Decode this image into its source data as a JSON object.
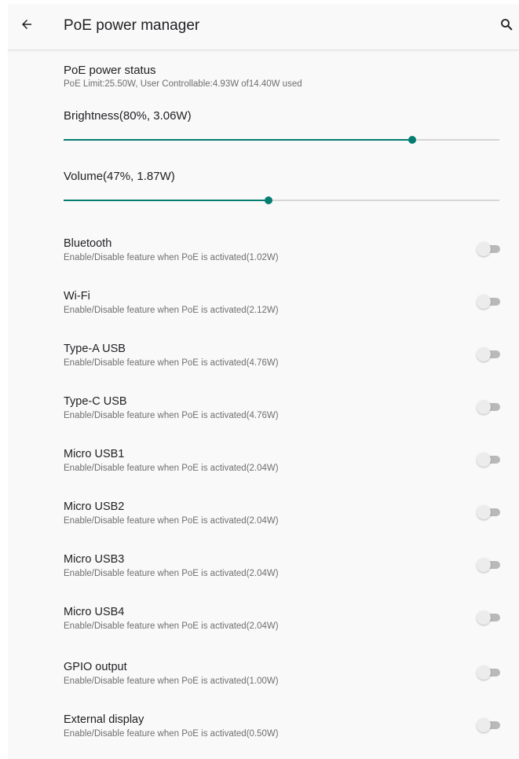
{
  "appbar": {
    "title": "PoE power manager",
    "back_icon": "arrow-back-icon",
    "search_icon": "search-icon"
  },
  "status": {
    "title": "PoE power status",
    "summary": "PoE Limit:25.50W, User Controllable:4.93W of14.40W used"
  },
  "sliders": [
    {
      "label": "Brightness(80%, 3.06W)",
      "percent": 80
    },
    {
      "label": "Volume(47%, 1.87W)",
      "percent": 47
    }
  ],
  "settings": [
    {
      "title": "Bluetooth",
      "subtitle": "Enable/Disable feature when PoE is activated(1.02W)",
      "enabled": false
    },
    {
      "title": "Wi-Fi",
      "subtitle": "Enable/Disable feature when PoE is activated(2.12W)",
      "enabled": false
    },
    {
      "title": "Type-A USB",
      "subtitle": "Enable/Disable feature when PoE is activated(4.76W)",
      "enabled": false
    },
    {
      "title": "Type-C USB",
      "subtitle": "Enable/Disable feature when PoE is activated(4.76W)",
      "enabled": false
    },
    {
      "title": "Micro USB1",
      "subtitle": "Enable/Disable feature when PoE is activated(2.04W)",
      "enabled": false
    },
    {
      "title": "Micro USB2",
      "subtitle": "Enable/Disable feature when PoE is activated(2.04W)",
      "enabled": false
    },
    {
      "title": "Micro USB3",
      "subtitle": "Enable/Disable feature when PoE is activated(2.04W)",
      "enabled": false
    },
    {
      "title": "Micro USB4",
      "subtitle": "Enable/Disable feature when PoE is activated(2.04W)",
      "enabled": false
    },
    {
      "title": "GPIO output",
      "subtitle": "Enable/Disable feature when PoE is activated(1.00W)",
      "enabled": false
    },
    {
      "title": "External display",
      "subtitle": "Enable/Disable feature when PoE is activated(0.50W)",
      "enabled": false
    }
  ],
  "colors": {
    "accent": "#047d71",
    "background": "#f9f9f9"
  }
}
